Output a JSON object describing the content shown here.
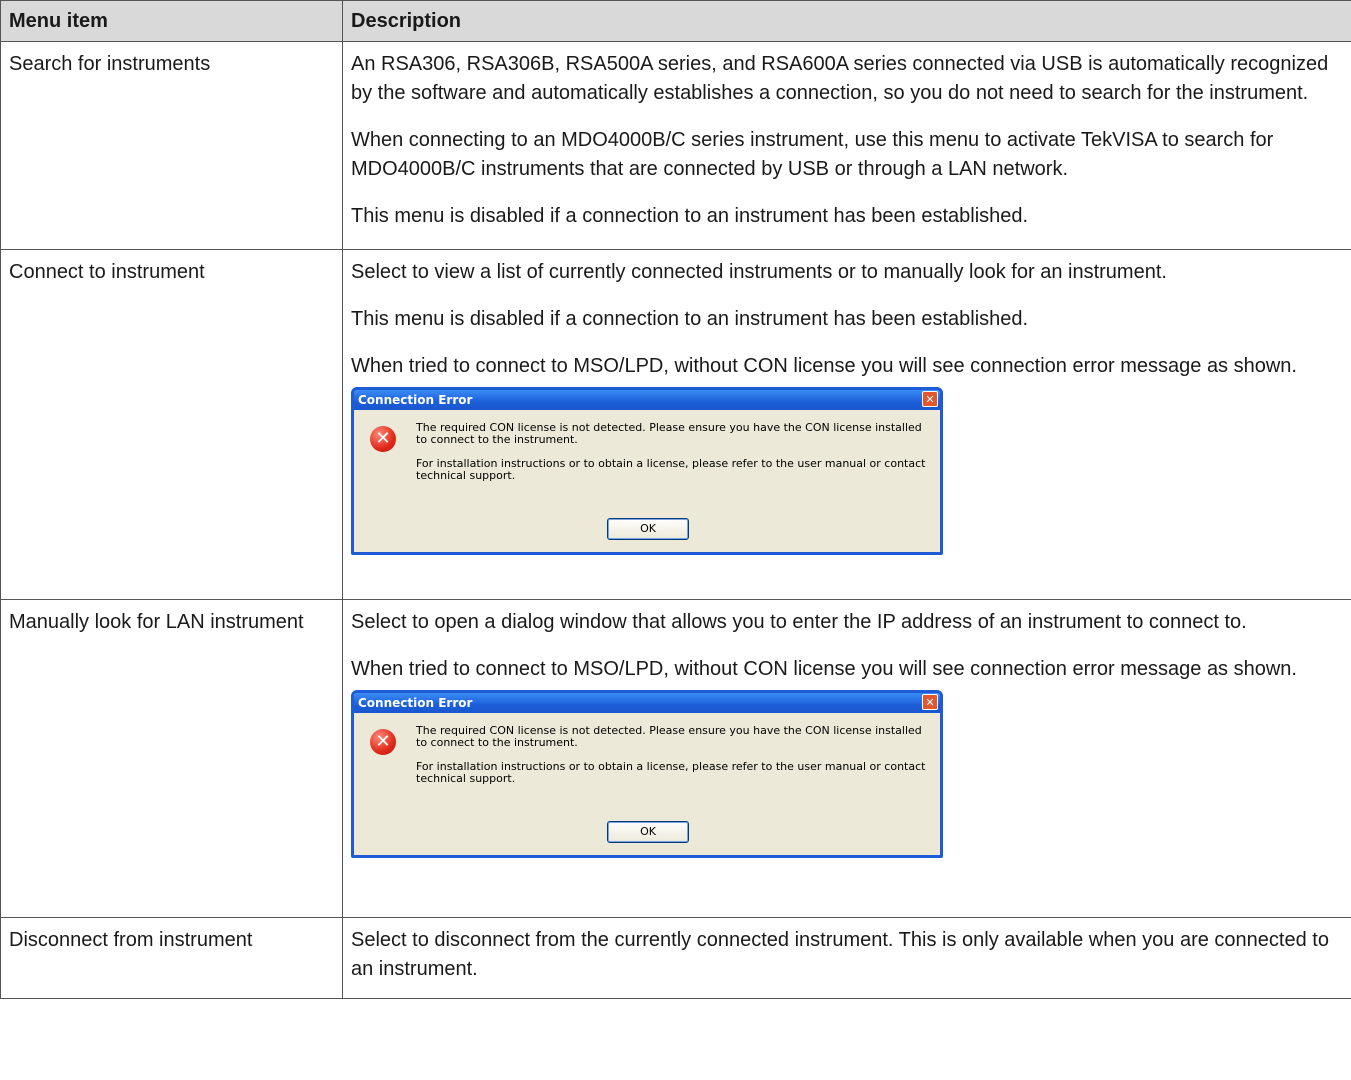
{
  "table": {
    "headers": [
      "Menu item",
      "Description"
    ],
    "rows": [
      {
        "item": "Search for instruments",
        "paragraphs": [
          "An RSA306, RSA306B, RSA500A series, and RSA600A series connected via USB is automatically recognized by the software and automatically establishes a connection, so you do not need to search for the instrument.",
          "When connecting to an MDO4000B/C series instrument, use this menu to activate TekVISA to search for MDO4000B/C instruments that are connected by USB or through a LAN network.",
          "This menu is disabled if a connection to an instrument has been established."
        ]
      },
      {
        "item": "Connect to instrument",
        "paragraphs": [
          "Select to view a list of currently connected instruments or to manually look for an instrument.",
          "This menu is disabled if a connection to an instrument has been established.",
          "When tried to connect to MSO/LPD, without CON license you will see connection error message as shown."
        ]
      },
      {
        "item": "Manually look for LAN instrument",
        "paragraphs": [
          "Select to open a dialog window that allows you to enter the IP address of an instrument to connect to.",
          "When tried to connect to MSO/LPD, without CON license you will see connection error message as shown."
        ]
      },
      {
        "item": "Disconnect from instrument",
        "paragraphs": [
          "Select to disconnect from the currently connected instrument. This is only available when you are connected to an instrument."
        ]
      }
    ]
  },
  "dialog": {
    "title": "Connection Error",
    "close_glyph": "✕",
    "icon": "error-icon",
    "message1": "The required CON license is not detected. Please ensure you have the CON license installed to connect to the instrument.",
    "message2": "For installation instructions or to obtain a license, please refer to the user manual or contact technical support.",
    "ok_label": "OK"
  },
  "colors": {
    "header_bg": "#d9d9d9",
    "border": "#555555",
    "dialog_title": "#1c5ed9",
    "dialog_bg": "#ece9d8"
  }
}
